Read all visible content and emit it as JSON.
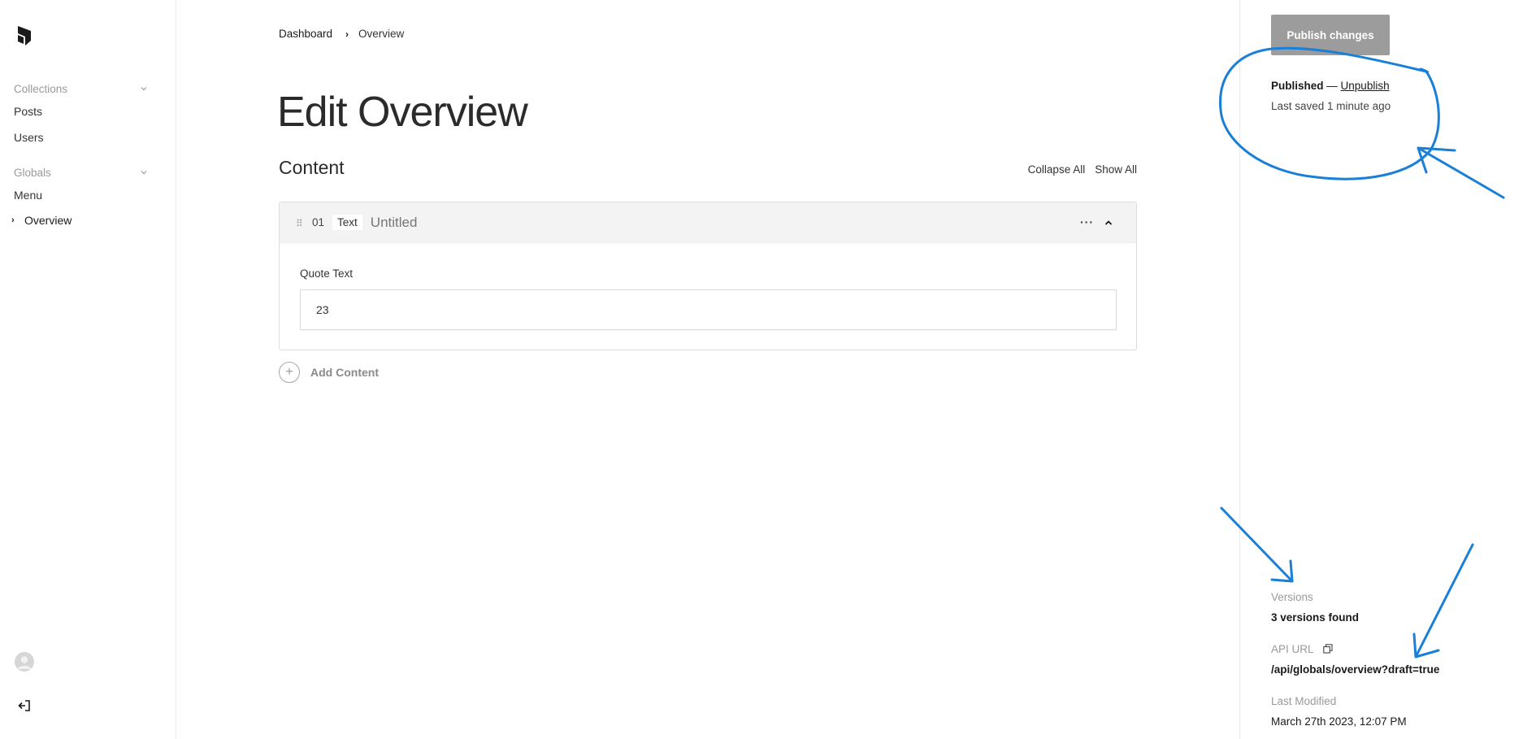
{
  "nav": {
    "groups": [
      {
        "label": "Collections",
        "items": [
          "Posts",
          "Users"
        ]
      },
      {
        "label": "Globals",
        "items": [
          "Menu",
          "Overview"
        ]
      }
    ],
    "active_item": "Overview",
    "icons": {
      "logo": "payload-logo-icon",
      "account": "avatar-icon",
      "logout": "logout-icon"
    }
  },
  "breadcrumb": {
    "root": "Dashboard",
    "current": "Overview"
  },
  "page": {
    "title": "Edit Overview"
  },
  "content": {
    "section_title": "Content",
    "collapse_all": "Collapse All",
    "show_all": "Show All",
    "blocks": [
      {
        "index": "01",
        "type": "Text",
        "label": "Untitled",
        "more": "···",
        "field_label": "Quote Text",
        "field_value": "23"
      }
    ],
    "add_label": "Add Content"
  },
  "sidebar": {
    "publish_button": "Publish changes",
    "status": "Published",
    "status_sep": "—",
    "unpublish": "Unpublish",
    "last_saved": "Last saved 1 minute ago",
    "versions_label": "Versions",
    "versions_value": "3 versions found",
    "api_label": "API URL",
    "api_value": "/api/globals/overview?draft=true",
    "modified_label": "Last Modified",
    "modified_value": "March 27th 2023, 12:07 PM"
  },
  "colors": {
    "annotation": "#1a7fd6",
    "publish_button_bg": "#9c9c9c"
  }
}
